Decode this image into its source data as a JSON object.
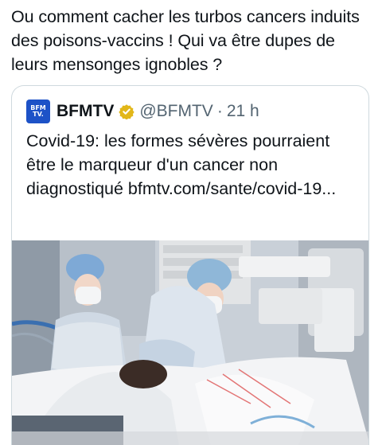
{
  "tweet": {
    "text": "Ou comment cacher les turbos cancers induits des poisons-vaccins ! Qui va être dupes de leurs mensonges ignobles ?"
  },
  "quoted_tweet": {
    "avatar_text_1": "BFM",
    "avatar_text_2": "TV.",
    "author_name": "BFMTV",
    "verified_icon": "verified-gold-badge-icon",
    "handle": "@BFMTV",
    "separator": "·",
    "time": "21 h",
    "text": "Covid-19: les formes sévères pourraient être le marqueur d'un cancer non diagnostiqué bfmtv.com/sante/covid-19...",
    "media": {
      "icon": "hospital-photo",
      "brand_color": "#1d52c7",
      "verified_color": "#e2b719"
    }
  }
}
